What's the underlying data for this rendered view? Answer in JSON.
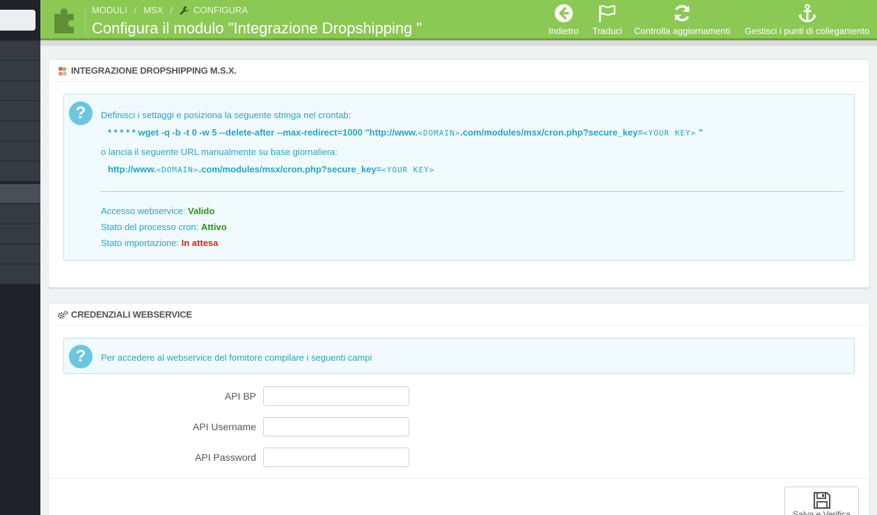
{
  "breadcrumb": {
    "items": [
      "MODULI",
      "MSX"
    ],
    "current": "CONFIGURA"
  },
  "page_title": "Configura il modulo \"Integrazione Dropshipping \"",
  "toolbar": [
    {
      "label": "Indietro",
      "icon": "back-arrow-icon"
    },
    {
      "label": "Traduci",
      "icon": "flag-icon"
    },
    {
      "label": "Controlla aggiornamenti",
      "icon": "refresh-icon"
    },
    {
      "label": "Gestisci i punti di collegamento",
      "icon": "anchor-icon"
    }
  ],
  "panel1": {
    "title": "INTEGRAZIONE DROPSHIPPING M.S.X.",
    "alert": {
      "line1": "Definisci i settaggi e posiziona la seguente stringa nel crontab:",
      "cron_prefix": "* * * * * wget -q -b -t 0 -w 5 --delete-after --max-redirect=1000 \"http://www.",
      "domain_token": "<DOMAIN>",
      "cron_middle": ".com/modules/msx/cron.php?secure_key=",
      "key_token": "<YOUR KEY>",
      "cron_suffix": " \"",
      "line3": "o lancia il seguente URL manualmente su base giornaliera:",
      "url_prefix": "http://www.",
      "url_middle": ".com/modules/msx/cron.php?secure_key=",
      "status": [
        {
          "label": "Accesso webservice:",
          "value": "Valido",
          "kind": "ok"
        },
        {
          "label": "Stato del processo cron:",
          "value": "Attivo",
          "kind": "ok"
        },
        {
          "label": "Stato importazione:",
          "value": "In attesa",
          "kind": "wait"
        }
      ]
    }
  },
  "panel2": {
    "title": "CREDENZIALI WEBSERVICE",
    "alert_text": "Per accedere al webservice del fornitore compilare i seguenti campi",
    "fields": [
      {
        "label": "API BP",
        "value": ""
      },
      {
        "label": "API Username",
        "value": ""
      },
      {
        "label": "API Password",
        "value": ""
      }
    ],
    "save_label": "Salva e Verifica"
  },
  "colors": {
    "header_green": "#8bc954",
    "info_blue": "#27a3c2",
    "ok_green": "#2e8f1c",
    "wait_red": "#e8201c"
  }
}
